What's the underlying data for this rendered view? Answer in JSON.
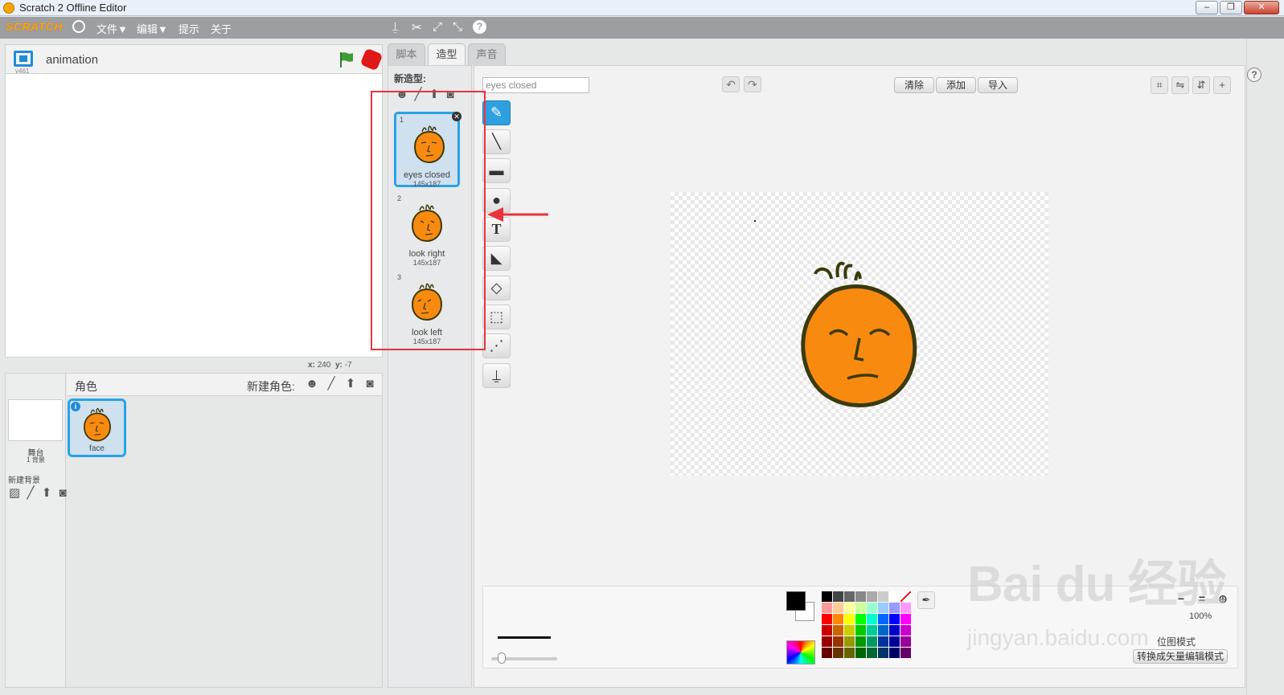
{
  "window": {
    "title": "Scratch 2 Offline Editor",
    "min": "–",
    "max": "❐",
    "close": "✕"
  },
  "menubar": {
    "logo": "SCRATCH",
    "file": "文件▼",
    "edit": "编辑▼",
    "tips": "提示",
    "about": "关于",
    "tools": [
      "duplicate-icon",
      "delete-icon",
      "grow-icon",
      "shrink-icon",
      "help-icon"
    ]
  },
  "stage": {
    "version": "v461",
    "project_title": "animation",
    "coords": {
      "x_label": "x:",
      "x": "240",
      "y_label": "y:",
      "y": "-7"
    }
  },
  "sprites": {
    "header_label": "角色",
    "new_sprite_label": "新建角色:",
    "stage_name": "舞台",
    "backdrop_count": "1 背景",
    "new_backdrop_label": "新建背景",
    "items": [
      {
        "name": "face",
        "info": "i"
      }
    ]
  },
  "tabs": [
    {
      "label": "脚本",
      "active": false
    },
    {
      "label": "造型",
      "active": true
    },
    {
      "label": "声音",
      "active": false
    }
  ],
  "costumes": {
    "new_label": "新造型:",
    "items": [
      {
        "num": "1",
        "name": "eyes closed",
        "size": "145x187",
        "selected": true
      },
      {
        "num": "2",
        "name": "look right",
        "size": "145x187",
        "selected": false
      },
      {
        "num": "3",
        "name": "look left",
        "size": "145x187",
        "selected": false
      }
    ]
  },
  "paint_editor": {
    "costume_name": "eyes closed",
    "clear": "清除",
    "add": "添加",
    "import": "导入",
    "zoom": "100%",
    "mode_label": "位图模式",
    "convert_button": "转换成矢量编辑模式",
    "tools": [
      "brush-tool",
      "line-tool",
      "rectangle-tool",
      "ellipse-tool",
      "text-tool",
      "fill-tool",
      "eraser-tool",
      "select-tool",
      "select-remove-bg-tool",
      "stamp-tool"
    ],
    "colors": {
      "primary": "#000000",
      "secondary": "#ffffff",
      "accent": "#2ea0e0",
      "face": "#f98a10",
      "outline": "#3a3a0a"
    }
  },
  "watermark": {
    "main": "Bai du 经验",
    "sub": "jingyan.baidu.com"
  }
}
